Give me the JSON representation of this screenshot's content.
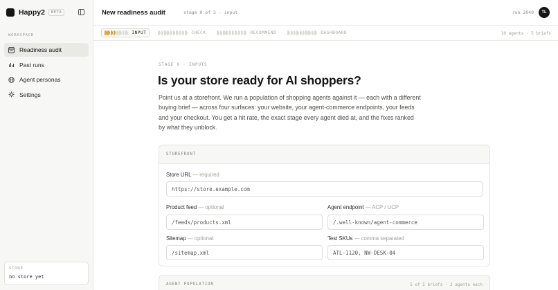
{
  "brand": {
    "name": "Happy2",
    "badge": "BETA"
  },
  "sidebar": {
    "section_label": "WORKSPACE",
    "items": [
      {
        "label": "Readiness audit",
        "icon": "audit-icon",
        "active": true
      },
      {
        "label": "Past runs",
        "icon": "chart-icon",
        "active": false
      },
      {
        "label": "Agent personas",
        "icon": "globe-icon",
        "active": false
      },
      {
        "label": "Settings",
        "icon": "gear-icon",
        "active": false
      }
    ],
    "store": {
      "label": "STORE",
      "value": "no store yet"
    }
  },
  "header": {
    "title": "New readiness audit",
    "stage_meta": "stage 0 of 3 · input",
    "run_label": "run 2049",
    "avatar_initials": "TL"
  },
  "stepper": {
    "steps": [
      {
        "label": "INPUT",
        "active": true
      },
      {
        "label": "CHECK",
        "active": false
      },
      {
        "label": "RECOMMEND",
        "active": false
      },
      {
        "label": "DASHBOARD",
        "active": false
      }
    ],
    "meta": "10 agents · 5 briefs"
  },
  "main": {
    "eyebrow": "STAGE 0 · INPUTS",
    "headline": "Is your store ready for AI shoppers?",
    "lede": "Point us at a storefront. We run a population of shopping agents against it — each with a different buying brief — across four surfaces: your website, your agent-commerce endpoints, your feeds and your checkout. You get a hit rate, the exact stage every agent died at, and the fixes ranked by what they unblock."
  },
  "storefront": {
    "heading": "STOREFRONT",
    "store_url": {
      "label": "Store URL",
      "hint": "— required",
      "placeholder": "https://store.example.com"
    },
    "product_feed": {
      "label": "Product feed",
      "hint": "— optional",
      "placeholder": "/feeds/products.xml"
    },
    "agent_endpoint": {
      "label": "Agent endpoint",
      "hint": "— ACP / UCP",
      "placeholder": "/.well-known/agent-commerce"
    },
    "sitemap": {
      "label": "Sitemap",
      "hint": "— optional",
      "placeholder": "/sitemap.xml"
    },
    "test_skus": {
      "label": "Test SKUs",
      "hint": "— comma separated",
      "placeholder": "ATL-1120, NW-DESK-04"
    }
  },
  "agent_population": {
    "heading": "AGENT POPULATION",
    "meta": "5 of 5 briefs · 2 agents each"
  },
  "colors": {
    "accent": "#e0a238",
    "ink": "#161616",
    "sidebar_bg": "#f7f7f5"
  }
}
